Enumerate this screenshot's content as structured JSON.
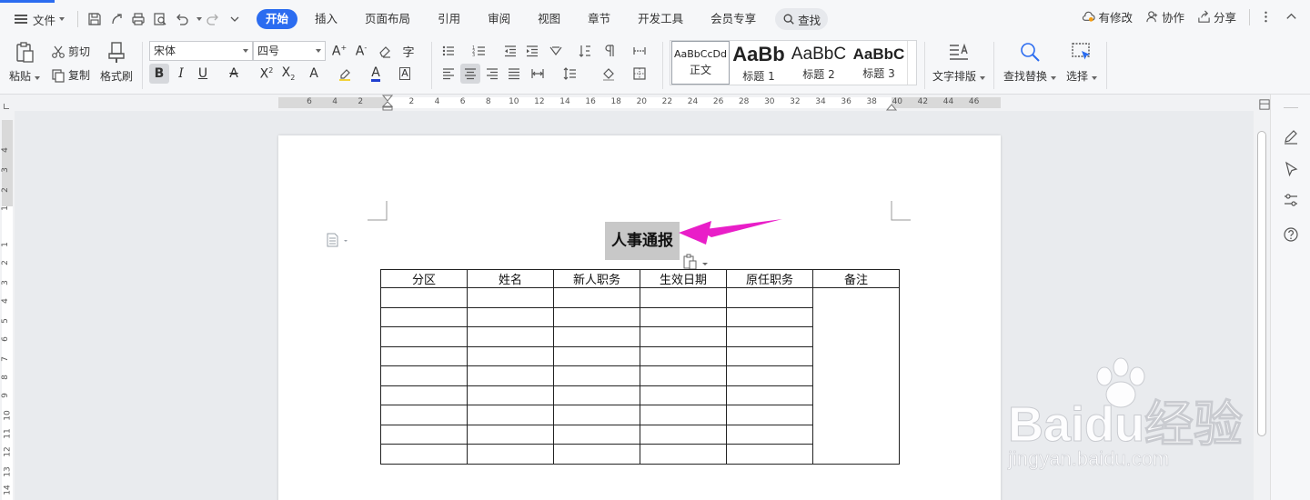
{
  "menubar": {
    "file_label": "文件",
    "tabs": [
      {
        "label": "开始",
        "active": true
      },
      {
        "label": "插入"
      },
      {
        "label": "页面布局"
      },
      {
        "label": "引用"
      },
      {
        "label": "审阅"
      },
      {
        "label": "视图"
      },
      {
        "label": "章节"
      },
      {
        "label": "开发工具"
      },
      {
        "label": "会员专享"
      }
    ],
    "search_label": "查找",
    "right": {
      "modified": "有修改",
      "collab": "协作",
      "share": "分享"
    }
  },
  "ribbon": {
    "paste": "粘贴",
    "cut": "剪切",
    "copy": "复制",
    "format_painter": "格式刷",
    "font_name": "宋体",
    "font_size": "四号",
    "styles": [
      {
        "sample": "AaBbCcDd",
        "name": "正文"
      },
      {
        "sample": "AaBb",
        "name": "标题 1"
      },
      {
        "sample": "AaBbC",
        "name": "标题 2"
      },
      {
        "sample": "AaBbC",
        "name": "标题 3"
      }
    ],
    "text_layout": "文字排版",
    "find_replace": "查找替换",
    "select": "选择"
  },
  "ruler": {
    "h_ticks": [
      "6",
      "4",
      "2",
      "2",
      "4",
      "6",
      "8",
      "10",
      "12",
      "14",
      "16",
      "18",
      "20",
      "22",
      "24",
      "26",
      "28",
      "30",
      "32",
      "34",
      "36",
      "38",
      "40",
      "42",
      "44",
      "46"
    ],
    "v_ticks": [
      "4",
      "3",
      "2",
      "1",
      "1",
      "2",
      "3",
      "4",
      "5",
      "6",
      "7",
      "8",
      "9",
      "10",
      "11",
      "12",
      "13",
      "14"
    ]
  },
  "document": {
    "title": "人事通报",
    "table": {
      "headers": [
        "分区",
        "姓名",
        "新人职务",
        "生效日期",
        "原任职务",
        "备注"
      ],
      "row_count": 9
    }
  },
  "watermark": {
    "brand": "Baidu经验",
    "url": "jingyan.baidu.com"
  },
  "colors": {
    "accent": "#2b6cf0",
    "arrow": "#e91ec8"
  }
}
